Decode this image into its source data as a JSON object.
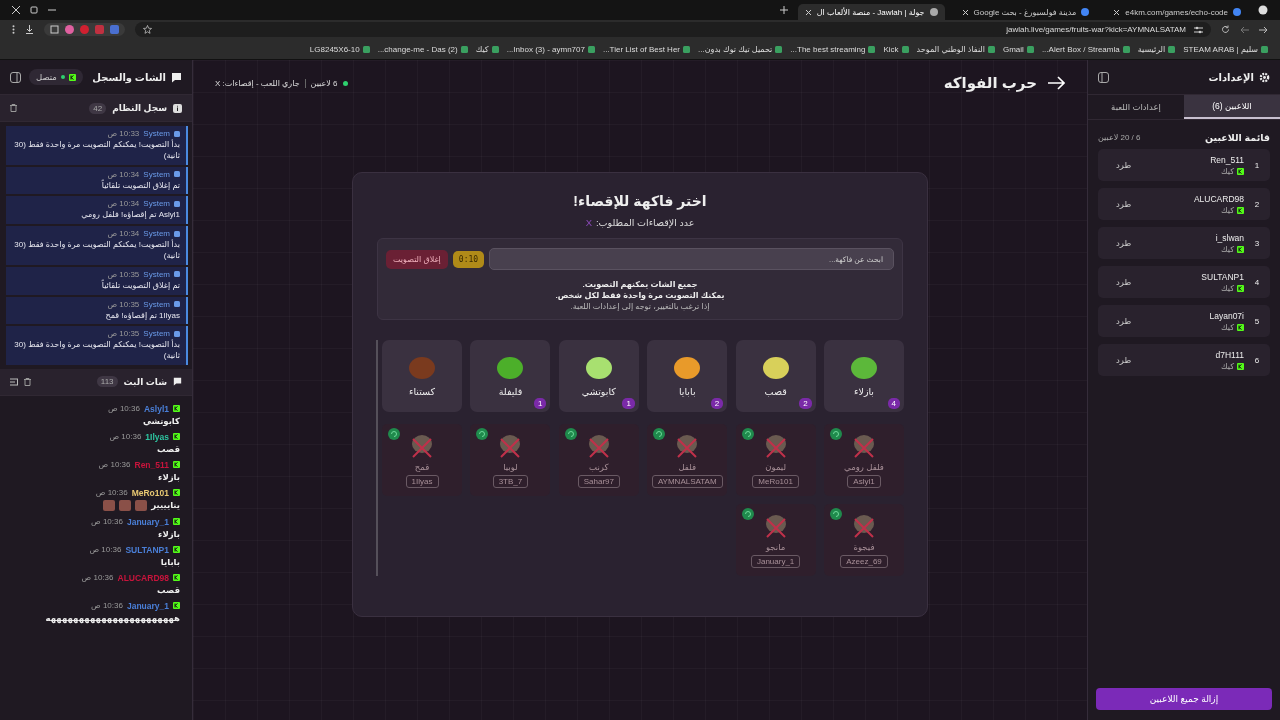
{
  "browser": {
    "tabs": [
      {
        "title": "e4km.com/games/echo-code",
        "selected": false
      },
      {
        "title": "مدينة فولسبورغ - بحث Google",
        "selected": false
      },
      {
        "title": "جولة | Jawlah - منصة الألعاب ال",
        "selected": true
      }
    ],
    "url": "jawlah.live/games/fruits-war?kick=AYMNALSATAM",
    "bookmarks": [
      {
        "title": "سليم | STEAM ARAB"
      },
      {
        "title": "الرئيسية"
      },
      {
        "title": "Alert Box / Streamla..."
      },
      {
        "title": "Gmail"
      },
      {
        "title": "النفاذ الوطني الموحد"
      },
      {
        "title": "Kick"
      },
      {
        "title": "The best streaming..."
      },
      {
        "title": "تحميل تيك توك بدون..."
      },
      {
        "title": "Tier List of Best Her..."
      },
      {
        "title": "Inbox (3) - aymn707..."
      },
      {
        "title": "كيك"
      },
      {
        "title": "(2) change-me - Das..."
      },
      {
        "title": "LG8245X6-10"
      }
    ]
  },
  "settings": {
    "title": "الإعدادات",
    "tabs": [
      {
        "label": "اللاعبين (6)",
        "selected": true
      },
      {
        "label": "إعدادات اللعبة",
        "selected": false
      }
    ],
    "list_title": "قائمة اللاعبين",
    "capacity": "6 / 20 لاعبين",
    "players": [
      {
        "rank": "1",
        "name": "Ren_511",
        "platform": "كيك",
        "action": "طرد"
      },
      {
        "rank": "2",
        "name": "ALUCARD98",
        "platform": "كيك",
        "action": "طرد"
      },
      {
        "rank": "3",
        "name": "i_slwan",
        "platform": "كيك",
        "action": "طرد"
      },
      {
        "rank": "4",
        "name": "SULTANP1",
        "platform": "كيك",
        "action": "طرد"
      },
      {
        "rank": "5",
        "name": "Layan07i",
        "platform": "كيك",
        "action": "طرد"
      },
      {
        "rank": "6",
        "name": "d7H111",
        "platform": "كيك",
        "action": "طرد"
      }
    ],
    "remove_all": "إزالة جميع اللاعبين"
  },
  "game": {
    "title": "حرب الفواكه",
    "players": "6 لاعبين",
    "state": "جاري اللعب - إقصاءات: X",
    "vote": {
      "title": "اختر فاكهة للإقصاء!",
      "required_label": "عدد الإقصاءات المطلوب:",
      "required_value": "X",
      "search": {
        "placeholder": "ابحث عن فاكهة..."
      },
      "timer": "0:10",
      "close_button": "إغلاق التصويت",
      "notes": [
        {
          "text": "جميع الشات يمكنهم التصويت.",
          "kind": "bold"
        },
        {
          "text": "يمكنك التصويت مرة واحدة فقط لكل شخص.",
          "kind": "bold"
        },
        {
          "text": "إذا ترغب بالتغيير، توجه إلى إعدادات اللعبة.",
          "kind": "hint"
        }
      ]
    },
    "fruits": [
      {
        "name": "بازلاء",
        "votes": "4",
        "color": "#5cb83a"
      },
      {
        "name": "قصب",
        "votes": "2",
        "color": "#d8d05a"
      },
      {
        "name": "بابايا",
        "votes": "2",
        "color": "#e89a2a"
      },
      {
        "name": "كابوتشي",
        "votes": "1",
        "color": "#a8e070"
      },
      {
        "name": "فليفلة",
        "votes": "1",
        "color": "#4caf2a"
      },
      {
        "name": "كستناء",
        "color": "#7a3a1e"
      }
    ],
    "eliminated": [
      {
        "fruit": "فلفل رومي",
        "player": "Aslyl1"
      },
      {
        "fruit": "ليمون",
        "player": "MeRo101"
      },
      {
        "fruit": "فلفل",
        "player": "AYMNALSATAM"
      },
      {
        "fruit": "كرنب",
        "player": "Sahar97"
      },
      {
        "fruit": "لوبيا",
        "player": "3TB_7"
      },
      {
        "fruit": "قمح",
        "player": "1Ilyas"
      },
      {
        "fruit": "فيجوة",
        "player": "Azeez_69"
      },
      {
        "fruit": "مانجو",
        "player": "January_1"
      }
    ]
  },
  "chat_panel": {
    "title": "الشات والسجل",
    "status": "متصل",
    "system_log": {
      "title": "سجل النظام",
      "count": "42",
      "entries": [
        {
          "sender": "System",
          "time": "10:33 ص",
          "text": "بدأ التصويت! يمكنكم التصويت مرة واحدة فقط (30 ثانية)"
        },
        {
          "sender": "System",
          "time": "10:34 ص",
          "text": "تم إغلاق التصويت تلقائياً"
        },
        {
          "sender": "System",
          "time": "10:34 ص",
          "text": "Aslyl1 تم إقصاؤه! فلفل رومي"
        },
        {
          "sender": "System",
          "time": "10:34 ص",
          "text": "بدأ التصويت! يمكنكم التصويت مرة واحدة فقط (30 ثانية)"
        },
        {
          "sender": "System",
          "time": "10:35 ص",
          "text": "تم إغلاق التصويت تلقائياً"
        },
        {
          "sender": "System",
          "time": "10:35 ص",
          "text": "1Ilyas تم إقصاؤه! قمح"
        },
        {
          "sender": "System",
          "time": "10:35 ص",
          "text": "بدأ التصويت! يمكنكم التصويت مرة واحدة فقط (30 ثانية)"
        }
      ]
    },
    "stream_chat": {
      "title": "شات البث",
      "count": "113",
      "messages": [
        {
          "user": "Aslyl1",
          "color": "#4a7fd8",
          "time": "10:36 ص",
          "text": "كابوتشي"
        },
        {
          "user": "1Ilyas",
          "color": "#2ec4a0",
          "time": "10:36 ص",
          "text": "قصب"
        },
        {
          "user": "Ren_511",
          "color": "#c8143c",
          "time": "10:36 ص",
          "text": "بازلاء"
        },
        {
          "user": "MeRo101",
          "color": "#e8c872",
          "time": "10:36 ص",
          "text": "ينايييير",
          "attachments": [
            {
              "kind": "emote"
            },
            {
              "kind": "emote"
            },
            {
              "kind": "emote"
            }
          ]
        },
        {
          "user": "January_1",
          "color": "#4a7fd8",
          "time": "10:36 ص",
          "text": "بازلاء"
        },
        {
          "user": "SULTANP1",
          "color": "#4a7fd8",
          "time": "10:36 ص",
          "text": "بابايا"
        },
        {
          "user": "ALUCARD98",
          "color": "#c8143c",
          "time": "10:36 ص",
          "text": "قصب"
        },
        {
          "user": "January_1",
          "color": "#4a7fd8",
          "time": "10:36 ص",
          "text": "هههههههههههههههههههههههه"
        }
      ]
    }
  }
}
